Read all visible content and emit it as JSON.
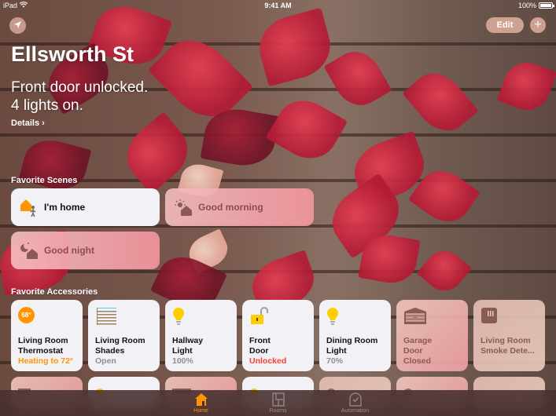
{
  "statusbar": {
    "device": "iPad",
    "time": "9:41 AM",
    "battery": "100%",
    "battery_level": 1.0
  },
  "toolbar": {
    "location_icon": "location-arrow-icon",
    "edit_label": "Edit",
    "add_label": "+"
  },
  "home": {
    "title": "Ellsworth St",
    "summary_line1": "Front door unlocked.",
    "summary_line2": "4 lights on.",
    "details_label": "Details ›"
  },
  "scenes": {
    "section_label": "Favorite Scenes",
    "items": [
      {
        "label": "I'm home",
        "icon": "arrive-home-icon",
        "active": true
      },
      {
        "label": "Good morning",
        "icon": "sunrise-home-icon",
        "active": false
      },
      {
        "label": "Good night",
        "icon": "moon-home-icon",
        "active": false
      }
    ]
  },
  "accessories": {
    "section_label": "Favorite Accessories",
    "items": [
      {
        "name_line1": "Living Room",
        "name_line2": "Thermostat",
        "state": "Heating to 72°",
        "icon": "thermostat-icon",
        "badge": "68°",
        "active": true,
        "state_color": "orange"
      },
      {
        "name_line1": "Living Room",
        "name_line2": "Shades",
        "state": "Open",
        "icon": "shades-icon",
        "active": true,
        "state_color": "grey"
      },
      {
        "name_line1": "Hallway",
        "name_line2": "Light",
        "state": "100%",
        "icon": "lightbulb-icon",
        "active": true,
        "state_color": "grey"
      },
      {
        "name_line1": "Front",
        "name_line2": "Door",
        "state": "Unlocked",
        "icon": "unlocked-lock-icon",
        "active": true,
        "state_color": "red"
      },
      {
        "name_line1": "Dining Room",
        "name_line2": "Light",
        "state": "70%",
        "icon": "lightbulb-icon",
        "active": true,
        "state_color": "grey"
      },
      {
        "name_line1": "Garage",
        "name_line2": "Door",
        "state": "Closed",
        "icon": "garage-door-icon",
        "active": false,
        "state_color": "dim"
      },
      {
        "name_line1": "Living Room",
        "name_line2": "Smoke Dete...",
        "state": "",
        "icon": "smoke-detector-icon",
        "active": false,
        "state_color": "dim"
      }
    ]
  },
  "tabbar": {
    "tabs": [
      {
        "label": "Home",
        "icon": "home-icon",
        "active": true
      },
      {
        "label": "Rooms",
        "icon": "rooms-icon",
        "active": false
      },
      {
        "label": "Automation",
        "icon": "automation-clock-icon",
        "active": false
      }
    ]
  },
  "colors": {
    "accent": "#ff9500",
    "alert": "#ff3b30",
    "tile_on": "#f2f1f5",
    "bulb": "#ffcc00"
  }
}
